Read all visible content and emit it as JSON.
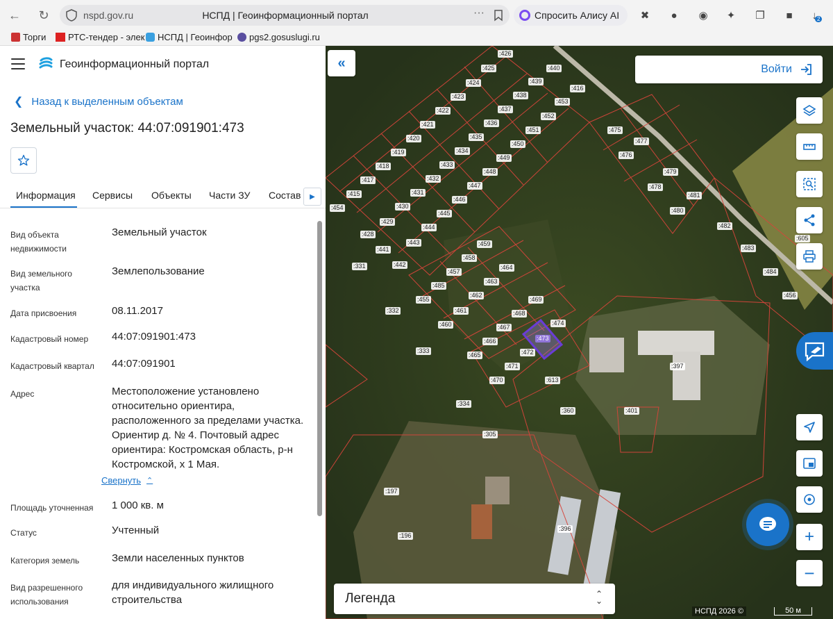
{
  "browser": {
    "url_host": "nspd.gov.ru",
    "page_title": "НСПД | Геоинформационный портал",
    "alice_label": "Спросить Алису AI",
    "bookmarks": [
      {
        "label": "Торги"
      },
      {
        "label": "РТС-тендер - элек"
      },
      {
        "label": "НСПД | Геоинфор"
      },
      {
        "label": "pgs2.gosuslugi.ru"
      }
    ],
    "downloads_badge": "2"
  },
  "panel": {
    "portal_title": "Геоинформационный портал",
    "back_label": "Назад к выделенным объектам",
    "object_title": "Земельный участок: 44:07:091901:473",
    "tabs": [
      {
        "label": "Информация"
      },
      {
        "label": "Сервисы"
      },
      {
        "label": "Объекты"
      },
      {
        "label": "Части ЗУ"
      },
      {
        "label": "Состав"
      }
    ],
    "properties": [
      {
        "label": "Вид объекта недвижимости",
        "value": "Земельный участок"
      },
      {
        "label": "Вид земельного участка",
        "value": "Землепользование"
      },
      {
        "label": "Дата присвоения",
        "value": "08.11.2017"
      },
      {
        "label": "Кадастровый номер",
        "value": "44:07:091901:473"
      },
      {
        "label": "Кадастровый квартал",
        "value": "44:07:091901"
      },
      {
        "label": "Адрес",
        "value": "Местоположение установлено относительно ориентира, расположенного за пределами участка. Ориентир д. № 4. Почтовый адрес ориентира: Костромская область, р-н Костромской, х 1 Мая."
      },
      {
        "label": "Площадь уточненная",
        "value": "1 000 кв. м"
      },
      {
        "label": "Статус",
        "value": "Учтенный"
      },
      {
        "label": "Категория земель",
        "value": "Земли населенных пунктов"
      },
      {
        "label": "Вид разрешенного использования",
        "value": "для индивидуального жилищного строительства"
      }
    ],
    "collapse_label": "Свернуть"
  },
  "map": {
    "login_label": "Войти",
    "legend_label": "Легенда",
    "copyright": "НСПД 2026 ©",
    "scale_label": "50 м",
    "selected_parcel": "473",
    "parcel_labels": [
      "426",
      "425",
      "440",
      "424",
      "439",
      "416",
      "423",
      "438",
      "453",
      "422",
      "437",
      "452",
      "421",
      "436",
      "451",
      "475",
      "420",
      "435",
      "450",
      "477",
      "419",
      "434",
      "449",
      "476",
      "418",
      "433",
      "448",
      "479",
      "417",
      "432",
      "447",
      "478",
      "481",
      "415",
      "431",
      "446",
      "454",
      "430",
      "445",
      "480",
      "482",
      "429",
      "444",
      "428",
      "443",
      "459",
      "483",
      "441",
      "458",
      "464",
      "331",
      "442",
      "457",
      "484",
      "485",
      "463",
      "456",
      "455",
      "462",
      "469",
      "332",
      "461",
      "468",
      "474",
      "460",
      "467",
      "473",
      "466",
      "472",
      "333",
      "465",
      "397",
      "471",
      "470",
      "613",
      "334",
      "360",
      "401",
      "305",
      "197",
      "196",
      "396",
      "605"
    ],
    "colors": {
      "accent": "#1a73c9",
      "parcel_border": "#d6453b",
      "selected": "#6a3cd6"
    }
  }
}
